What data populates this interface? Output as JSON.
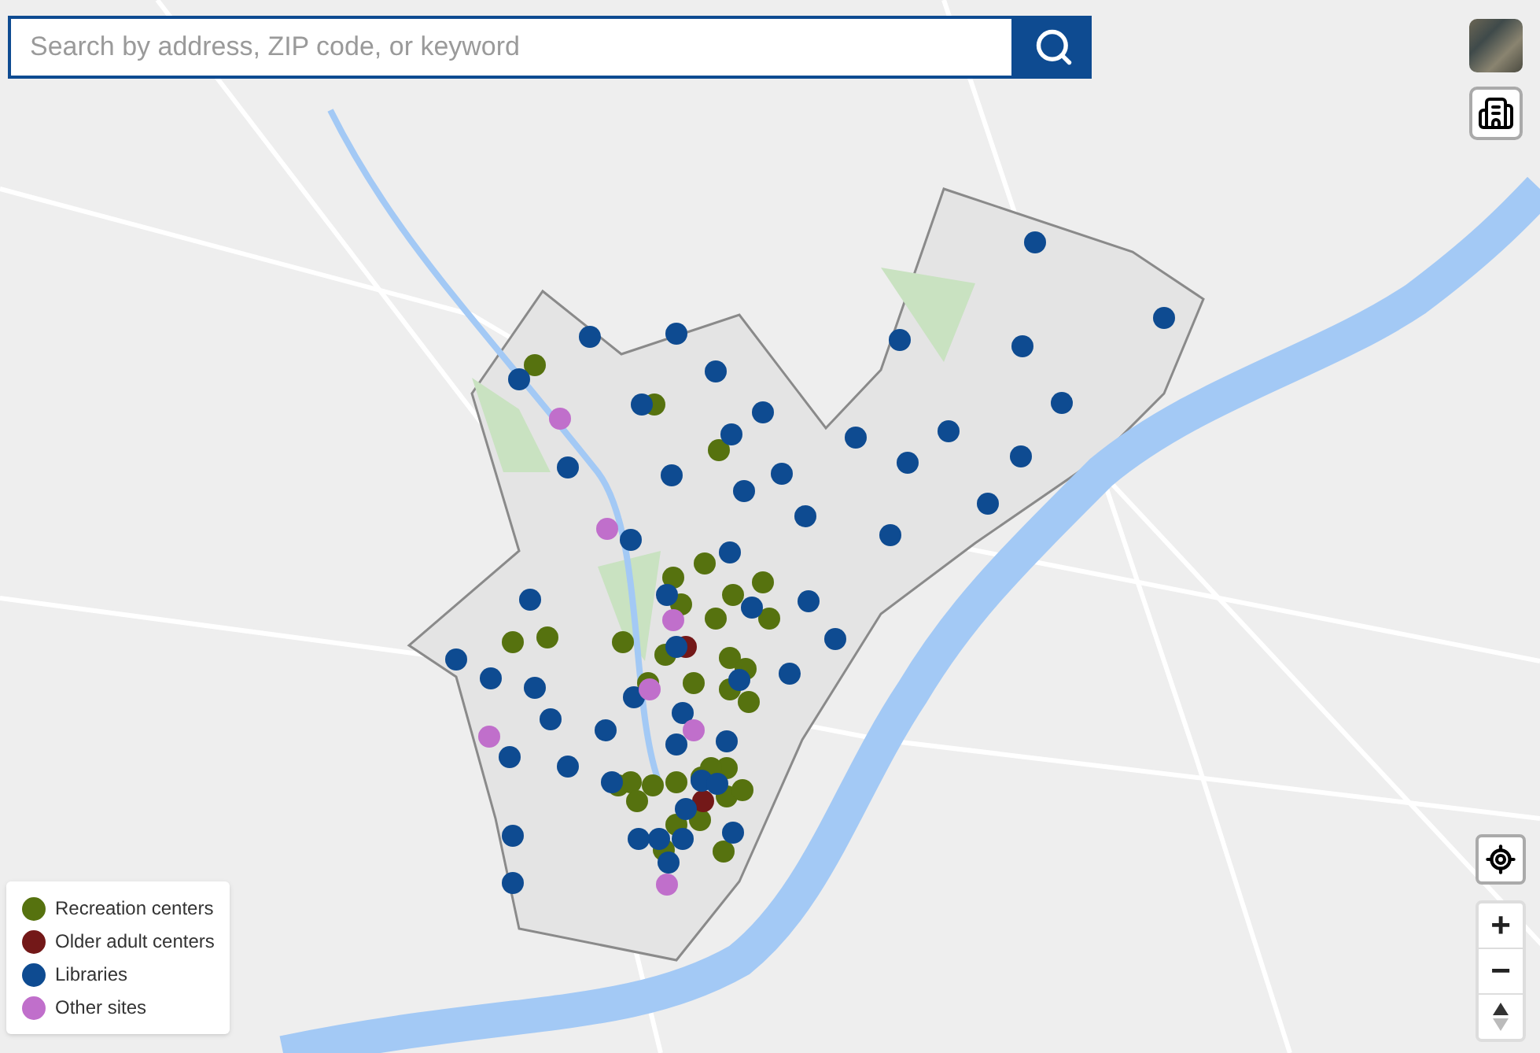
{
  "search": {
    "placeholder": "Search by address, ZIP code, or keyword"
  },
  "map_controls": {
    "zoom_in": "+",
    "zoom_out": "−"
  },
  "legend": [
    {
      "label": "Recreation centers",
      "color": "#56720f"
    },
    {
      "label": "Older adult centers",
      "color": "#731818"
    },
    {
      "label": "Libraries",
      "color": "#0e4b91"
    },
    {
      "label": "Other sites",
      "color": "#c06fcb"
    }
  ]
}
